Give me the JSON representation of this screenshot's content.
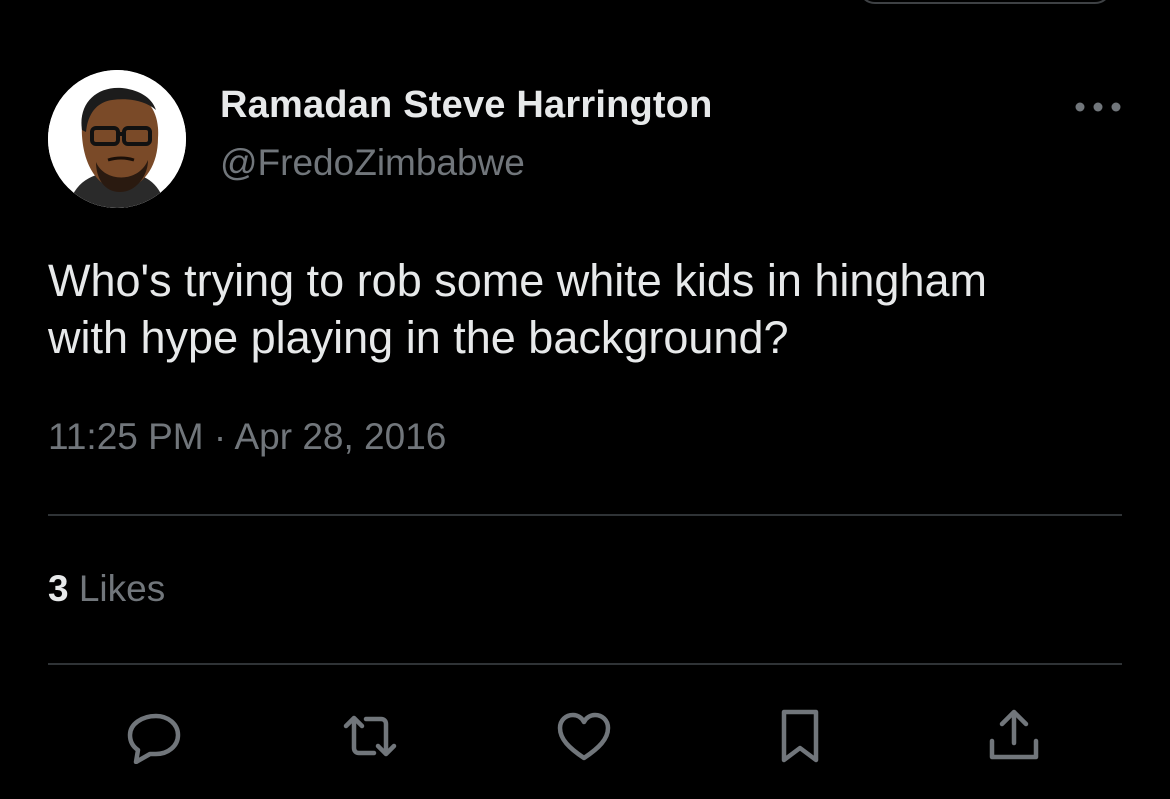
{
  "tweet": {
    "author_name": "Ramadan Steve Harrington",
    "author_handle": "@FredoZimbabwe",
    "text_line_1": "Who's trying to rob some white kids in hingham",
    "text_line_2": "with hype playing in the background?",
    "timestamp": "11:25 PM · Apr 28, 2016",
    "likes_count": "3",
    "likes_label": "Likes"
  },
  "icons": {
    "more": "ellipsis-icon",
    "reply": "speech-bubble-icon",
    "retweet": "retweet-arrows-icon",
    "like": "heart-icon",
    "bookmark": "bookmark-icon",
    "share": "share-upload-icon"
  },
  "colors": {
    "background": "#000000",
    "primary_text": "#e7e9ea",
    "secondary_text": "#71767b",
    "divider": "#2f3336",
    "icon": "#71767b"
  }
}
